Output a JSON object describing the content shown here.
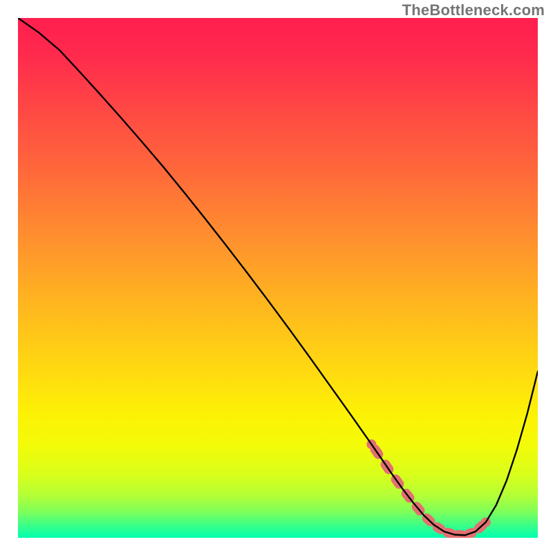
{
  "attribution": "TheBottleneck.com",
  "gradient": {
    "stops": [
      {
        "offset": 0.0,
        "color": "#ff1f4f"
      },
      {
        "offset": 0.07,
        "color": "#ff2a4d"
      },
      {
        "offset": 0.18,
        "color": "#ff4944"
      },
      {
        "offset": 0.3,
        "color": "#ff6a3a"
      },
      {
        "offset": 0.42,
        "color": "#ff8f2f"
      },
      {
        "offset": 0.55,
        "color": "#ffb61f"
      },
      {
        "offset": 0.68,
        "color": "#ffda10"
      },
      {
        "offset": 0.76,
        "color": "#fdf106"
      },
      {
        "offset": 0.82,
        "color": "#f4fb08"
      },
      {
        "offset": 0.88,
        "color": "#d8ff1c"
      },
      {
        "offset": 0.92,
        "color": "#b2ff38"
      },
      {
        "offset": 0.95,
        "color": "#7eff5a"
      },
      {
        "offset": 0.975,
        "color": "#3dff86"
      },
      {
        "offset": 1.0,
        "color": "#00ffb0"
      }
    ]
  },
  "chart_data": {
    "type": "line",
    "title": "",
    "xlabel": "",
    "ylabel": "",
    "xlim": [
      0,
      100
    ],
    "ylim": [
      0,
      100
    ],
    "grid": false,
    "legend": false,
    "series": [
      {
        "name": "bottleneck-curve",
        "x": [
          0,
          4,
          8,
          12,
          16,
          20,
          24,
          28,
          32,
          36,
          40,
          44,
          48,
          52,
          56,
          60,
          64,
          68,
          70,
          72,
          74,
          76,
          78,
          80,
          82,
          84,
          86,
          88,
          90,
          92,
          94,
          96,
          98,
          100
        ],
        "values": [
          100,
          97.2,
          93.8,
          89.5,
          85.1,
          80.6,
          76.0,
          71.3,
          66.4,
          61.4,
          56.3,
          51.1,
          45.8,
          40.4,
          34.9,
          29.3,
          23.7,
          18.0,
          15.1,
          12.2,
          9.4,
          6.8,
          4.4,
          2.5,
          1.2,
          0.6,
          0.5,
          1.2,
          3.0,
          6.3,
          11.0,
          17.0,
          24.0,
          32.0
        ]
      }
    ],
    "markers": {
      "name": "marker-band",
      "color": "#e27070",
      "x": [
        68,
        70,
        72,
        74,
        76,
        78,
        80,
        82,
        84,
        86,
        88,
        90
      ],
      "values": [
        18.0,
        15.1,
        12.2,
        9.4,
        6.8,
        4.4,
        2.5,
        1.2,
        0.6,
        0.5,
        1.2,
        3.0
      ]
    }
  }
}
